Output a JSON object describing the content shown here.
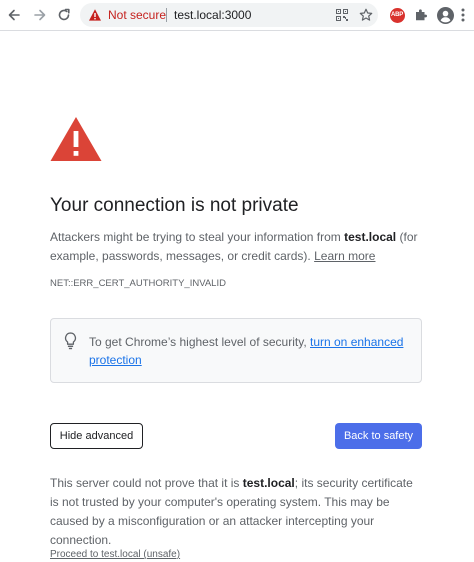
{
  "browser": {
    "security_label": "Not secure",
    "url": "test.local:3000",
    "abp_badge": "ABP",
    "colors": {
      "not_secure": "#c5221f",
      "omnibox_bg": "#f1f3f4",
      "abp": "#d9322d"
    },
    "icons": [
      "back-arrow-icon",
      "forward-arrow-icon",
      "reload-icon",
      "warning-triangle-icon",
      "qr-code-icon",
      "star-icon",
      "adblock-plus-icon",
      "extensions-puzzle-icon",
      "profile-avatar-icon"
    ]
  },
  "page": {
    "heading": "Your connection is not private",
    "main_message": {
      "before": "Attackers might be trying to steal your information from ",
      "host": "test.local",
      "after": " (for example, passwords, messages, or credit cards). ",
      "learn_more": "Learn more"
    },
    "error_code": "NET::ERR_CERT_AUTHORITY_INVALID",
    "enhanced_protection": {
      "text": "To get Chrome’s highest level of security, ",
      "link": "turn on enhanced protection"
    },
    "hide_advanced_label": "Hide advanced",
    "back_to_safety_label": "Back to safety",
    "details": {
      "before": "This server could not prove that it is ",
      "host": "test.local",
      "after": "; its security certificate is not trusted by your computer's operating system. This may be caused by a misconfiguration or an attacker intercepting your connection."
    },
    "proceed_link": "Proceed to test.local (unsafe)",
    "colors": {
      "warning_red": "#db4437",
      "primary_button": "#4c6ee9",
      "link_blue": "#1a73e8"
    }
  }
}
